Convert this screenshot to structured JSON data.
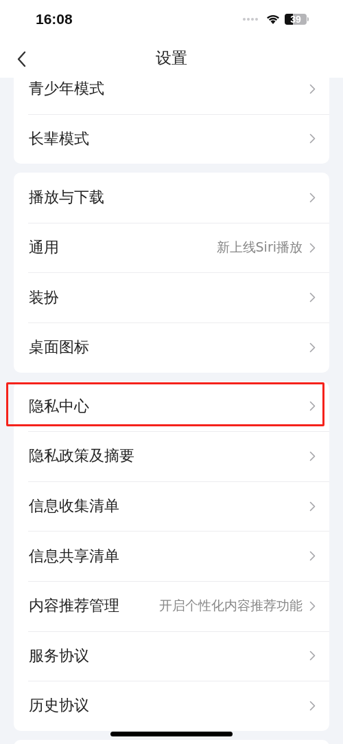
{
  "status_bar": {
    "time": "16:08",
    "battery": "39"
  },
  "nav_bar": {
    "title": "设置"
  },
  "groups": [
    {
      "items": [
        {
          "label": "青少年模式",
          "highlighted": false
        },
        {
          "label": "长辈模式",
          "highlighted": false
        }
      ]
    },
    {
      "items": [
        {
          "label": "播放与下载",
          "highlighted": false
        },
        {
          "label": "通用",
          "value": "新上线Siri播放",
          "highlighted": false
        },
        {
          "label": "装扮",
          "highlighted": false
        },
        {
          "label": "桌面图标",
          "highlighted": false
        }
      ]
    },
    {
      "items": [
        {
          "label": "隐私中心",
          "highlighted": true
        },
        {
          "label": "隐私政策及摘要",
          "highlighted": false
        },
        {
          "label": "信息收集清单",
          "highlighted": false
        },
        {
          "label": "信息共享清单",
          "highlighted": false
        },
        {
          "label": "内容推荐管理",
          "value": "开启个性化内容推荐功能",
          "highlighted": false
        },
        {
          "label": "服务协议",
          "highlighted": false
        },
        {
          "label": "历史协议",
          "highlighted": false
        }
      ]
    },
    {
      "kind": "card"
    }
  ]
}
